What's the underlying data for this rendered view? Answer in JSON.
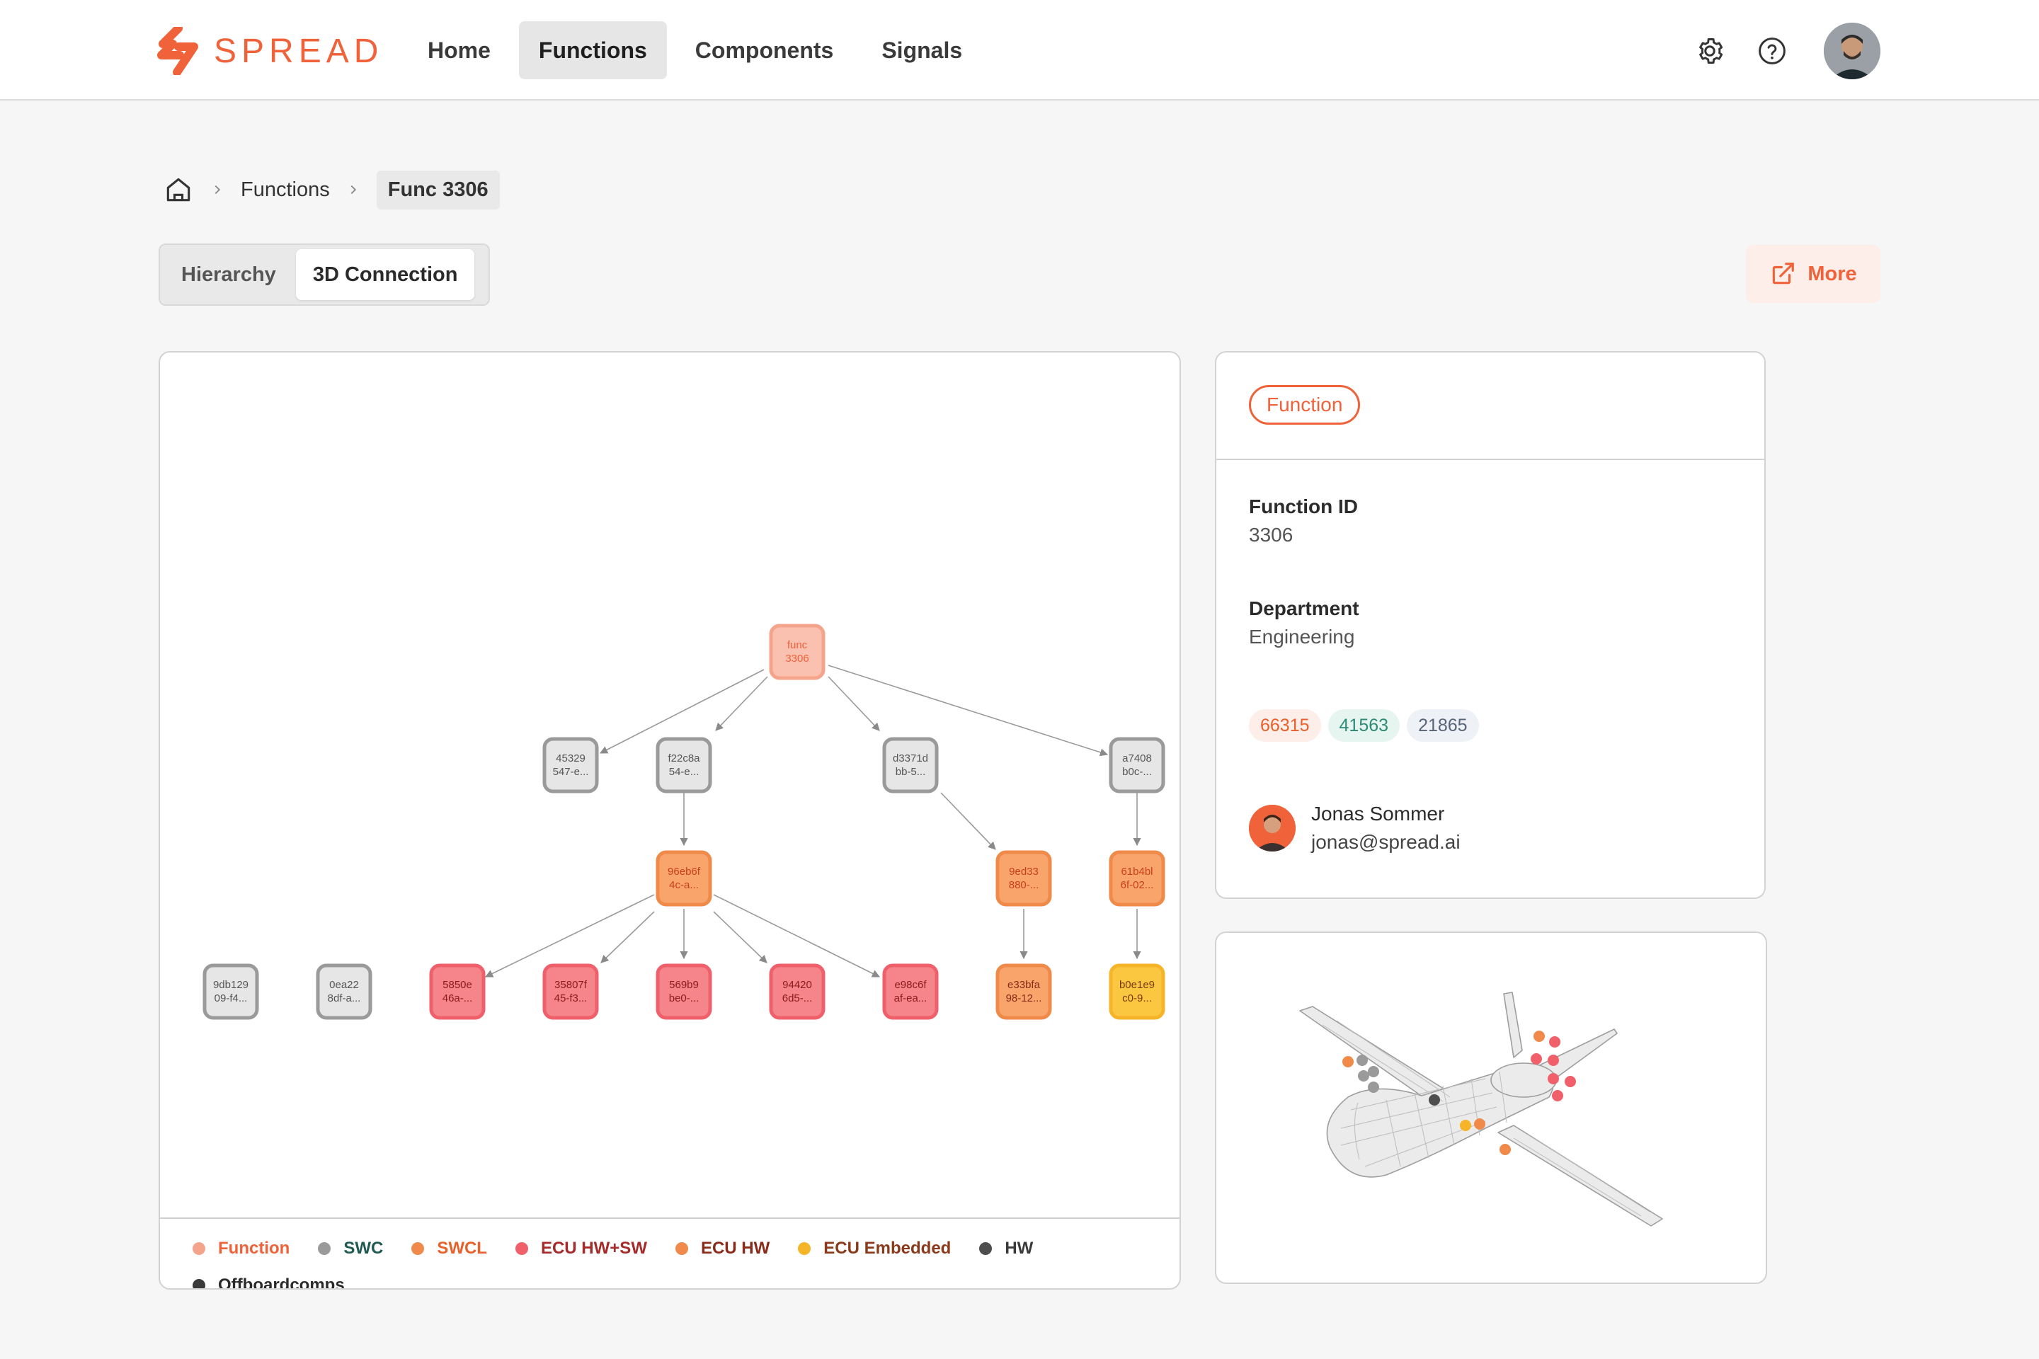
{
  "app": {
    "brand": "SPREAD",
    "brand_color": "#f0623a"
  },
  "nav": {
    "items": [
      {
        "label": "Home",
        "active": false
      },
      {
        "label": "Functions",
        "active": true
      },
      {
        "label": "Components",
        "active": false
      },
      {
        "label": "Signals",
        "active": false
      }
    ]
  },
  "header": {
    "settings_icon": "gear-icon",
    "help_icon": "help-circle-icon"
  },
  "breadcrumb": {
    "items": [
      "Functions"
    ],
    "current": "Func 3306"
  },
  "view_tabs": {
    "tabs": [
      "Hierarchy",
      "3D Connection"
    ],
    "active": "3D Connection"
  },
  "more_button": {
    "label": "More",
    "icon": "external-link-icon"
  },
  "graph": {
    "nodes": {
      "root": [
        "func",
        "3306"
      ],
      "n1": [
        "45329",
        "547-e..."
      ],
      "n2": [
        "f22c8a",
        "54-e..."
      ],
      "n3": [
        "d3371d",
        "bb-5..."
      ],
      "n4": [
        "a7408",
        "b0c-..."
      ],
      "n5": [
        "96eb6f",
        "4c-a..."
      ],
      "n6": [
        "9ed33",
        "880-..."
      ],
      "n7": [
        "61b4bl",
        "6f-02..."
      ],
      "n8": [
        "9db129",
        "09-f4..."
      ],
      "n9": [
        "0ea22",
        "8df-a..."
      ],
      "n10": [
        "5850e",
        "46a-..."
      ],
      "n11": [
        "35807f",
        "45-f3..."
      ],
      "n12": [
        "569b9",
        "be0-..."
      ],
      "n13": [
        "94420",
        "6d5-..."
      ],
      "n14": [
        "e98c6f",
        "af-ea..."
      ],
      "n15": [
        "e33bfa",
        "98-12..."
      ],
      "n16": [
        "b0e1e9",
        "c0-9..."
      ]
    }
  },
  "legend": {
    "items": [
      {
        "label": "Function",
        "color": "#f5a48c",
        "text_color": "#f0623a"
      },
      {
        "label": "SWC",
        "color": "#9a9a9a",
        "text_color": "#1e5a52"
      },
      {
        "label": "SWCL",
        "color": "#f08a4b",
        "text_color": "#e8602a"
      },
      {
        "label": "ECU HW+SW",
        "color": "#f0606a",
        "text_color": "#a52a2a"
      },
      {
        "label": "ECU HW",
        "color": "#f08a4b",
        "text_color": "#8a2a1a"
      },
      {
        "label": "ECU Embedded",
        "color": "#f6b428",
        "text_color": "#8a3a1a"
      },
      {
        "label": "HW",
        "color": "#4e4e4e",
        "text_color": "#3a3a3a"
      },
      {
        "label": "Offboardcomps",
        "color": "#3a3a3a",
        "text_color": "#2b2b2b"
      }
    ]
  },
  "details": {
    "type_badge": "Function",
    "function_id_label": "Function ID",
    "function_id": "3306",
    "department_label": "Department",
    "department": "Engineering",
    "tags": [
      {
        "label": "66315",
        "bg": "#fdeee9",
        "fg": "#e8602a"
      },
      {
        "label": "41563",
        "bg": "#e7f5f1",
        "fg": "#2e8a74"
      },
      {
        "label": "21865",
        "bg": "#eef1f6",
        "fg": "#5a6478"
      }
    ],
    "owner": {
      "name": "Jonas Sommer",
      "email": "jonas@spread.ai"
    }
  }
}
